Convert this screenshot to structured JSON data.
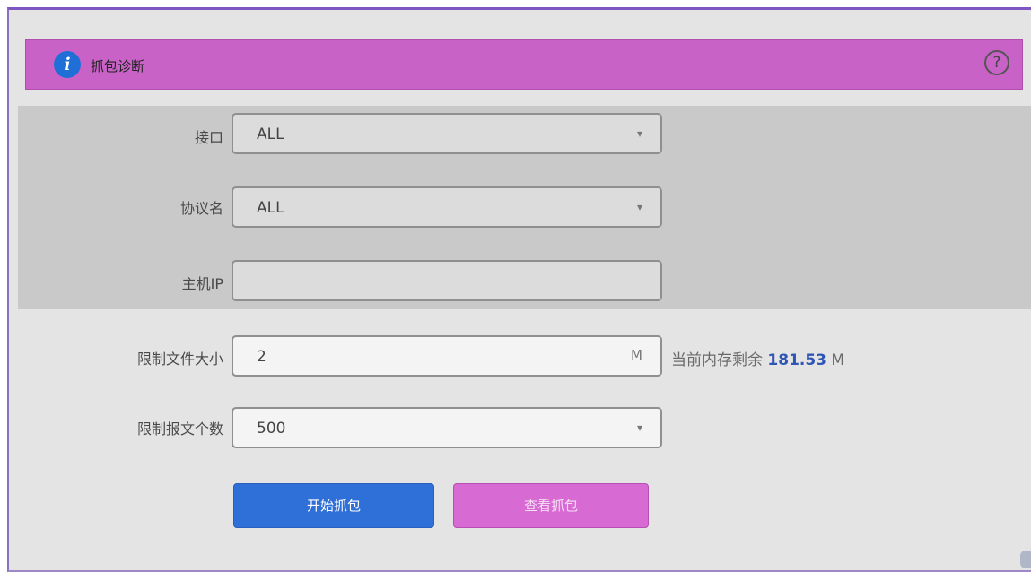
{
  "header": {
    "title": "抓包诊断",
    "info_icon": "i"
  },
  "form": {
    "interface": {
      "label": "接口",
      "value": "ALL"
    },
    "protocol": {
      "label": "协议名",
      "value": "ALL"
    },
    "host_ip": {
      "label": "主机IP",
      "value": ""
    },
    "file_size": {
      "label": "限制文件大小",
      "value": "2",
      "unit": "M"
    },
    "packet_count": {
      "label": "限制报文个数",
      "value": "500"
    }
  },
  "memory": {
    "prefix": "当前内存剩余 ",
    "value": "181.53",
    "unit": " M"
  },
  "buttons": {
    "start": "开始抓包",
    "view": "查看抓包"
  },
  "colors": {
    "header": "#c962c6",
    "primary": "#2f6fd8",
    "secondary_button": "#d86ad4",
    "memory_value": "#2f55b5"
  }
}
